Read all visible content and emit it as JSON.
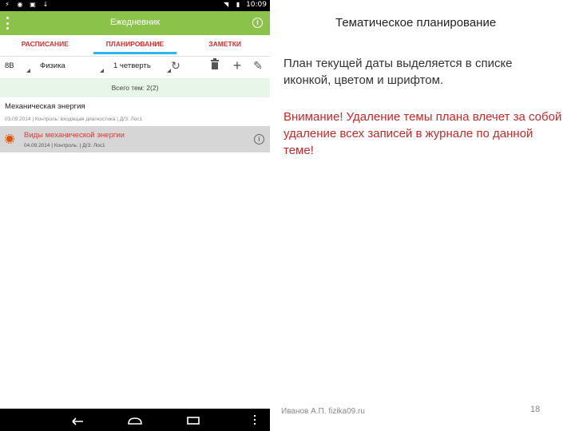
{
  "status_bar": {
    "time": "10:09"
  },
  "app_bar": {
    "title": "Ежедневник"
  },
  "tabs": [
    {
      "label": "РАСПИСАНИЕ",
      "active": false
    },
    {
      "label": "ПЛАНИРОВАНИЕ",
      "active": true
    },
    {
      "label": "ЗАМЕТКИ",
      "active": false
    }
  ],
  "toolbar": {
    "class_value": "8В",
    "subject_value": "Физика",
    "period_value": "1 четверть",
    "icons": [
      "refresh-icon",
      "trash-icon",
      "plus-icon",
      "pencil-icon"
    ]
  },
  "summary": {
    "text": "Всего тем: 2(2)"
  },
  "list": {
    "header": "Механическая энергия",
    "row1_sub": "03.09.2014 | Контроль: входящая диагностика | Д/З: Лос1",
    "row2_title": "Виды механической энергии",
    "row2_sub": "04.09.2014 | Контроль: | Д/З: Лос1"
  },
  "slide": {
    "title": "Тематическое планирование",
    "paragraph1": "План текущей даты выделяется в списке иконкой, цветом и шрифтом.",
    "paragraph2": "Внимание! Удаление темы плана влечет за собой удаление всех записей в журнале по данной теме!",
    "footer_author": "Иванов А.П. fizika09.ru",
    "page_number": "18"
  },
  "colors": {
    "app_bar": "#8bc34a",
    "tab_text": "#d32f2f",
    "tab_indicator": "#29b6f6",
    "warning_text": "#c62828",
    "highlight_row": "#d6d6d6"
  }
}
